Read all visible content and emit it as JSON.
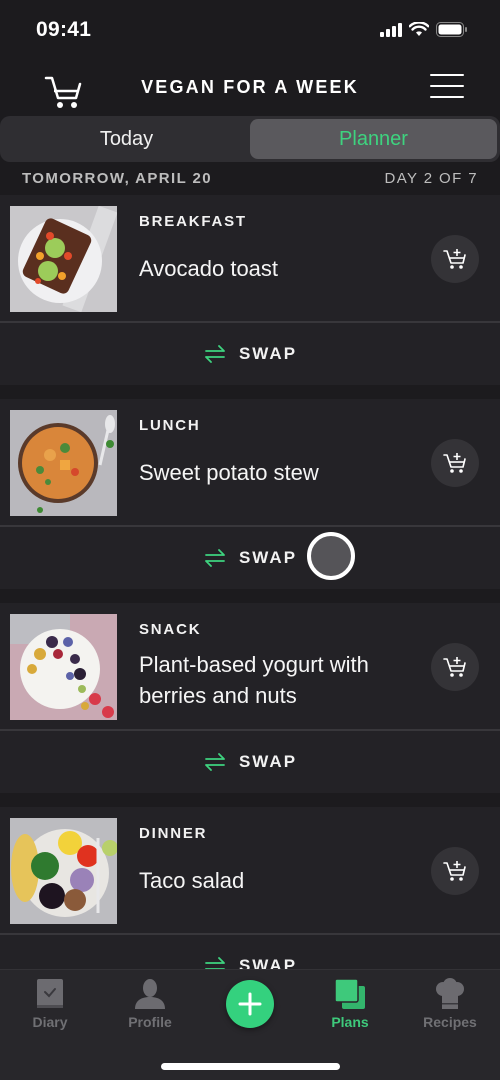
{
  "status_bar": {
    "time": "09:41",
    "icons": [
      "cellular-signal-icon",
      "wifi-icon",
      "battery-icon"
    ]
  },
  "header": {
    "title": "VEGAN FOR A WEEK",
    "left_icon": "shopping-cart-icon",
    "right_icon": "hamburger-menu-icon"
  },
  "segmented_control": {
    "tabs": [
      {
        "label": "Today",
        "active": false
      },
      {
        "label": "Planner",
        "active": true
      }
    ]
  },
  "date_row": {
    "date": "TOMORROW, APRIL 20",
    "day_progress": "DAY 2 OF 7"
  },
  "meals": [
    {
      "type": "BREAKFAST",
      "name": "Avocado toast",
      "image": "avocado-toast-photo",
      "swap_label": "SWAP"
    },
    {
      "type": "LUNCH",
      "name": "Sweet potato stew",
      "image": "sweet-potato-stew-photo",
      "swap_label": "SWAP"
    },
    {
      "type": "SNACK",
      "name": "Plant-based yogurt with berries and nuts",
      "image": "yogurt-berries-photo",
      "swap_label": "SWAP"
    },
    {
      "type": "DINNER",
      "name": "Taco salad",
      "image": "taco-salad-photo",
      "swap_label": "SWAP"
    }
  ],
  "tab_bar": {
    "items": [
      {
        "label": "Diary",
        "icon": "diary-book-icon",
        "active": false
      },
      {
        "label": "Profile",
        "icon": "person-icon",
        "active": false
      },
      {
        "label": "",
        "icon": "plus-icon",
        "active": false
      },
      {
        "label": "Plans",
        "icon": "plans-stack-icon",
        "active": true
      },
      {
        "label": "Recipes",
        "icon": "chef-hat-icon",
        "active": false
      }
    ]
  },
  "colors": {
    "accent": "#3ed37f",
    "background": "#1c1b1e",
    "card": "#232226",
    "tab_inactive": "#707074"
  }
}
